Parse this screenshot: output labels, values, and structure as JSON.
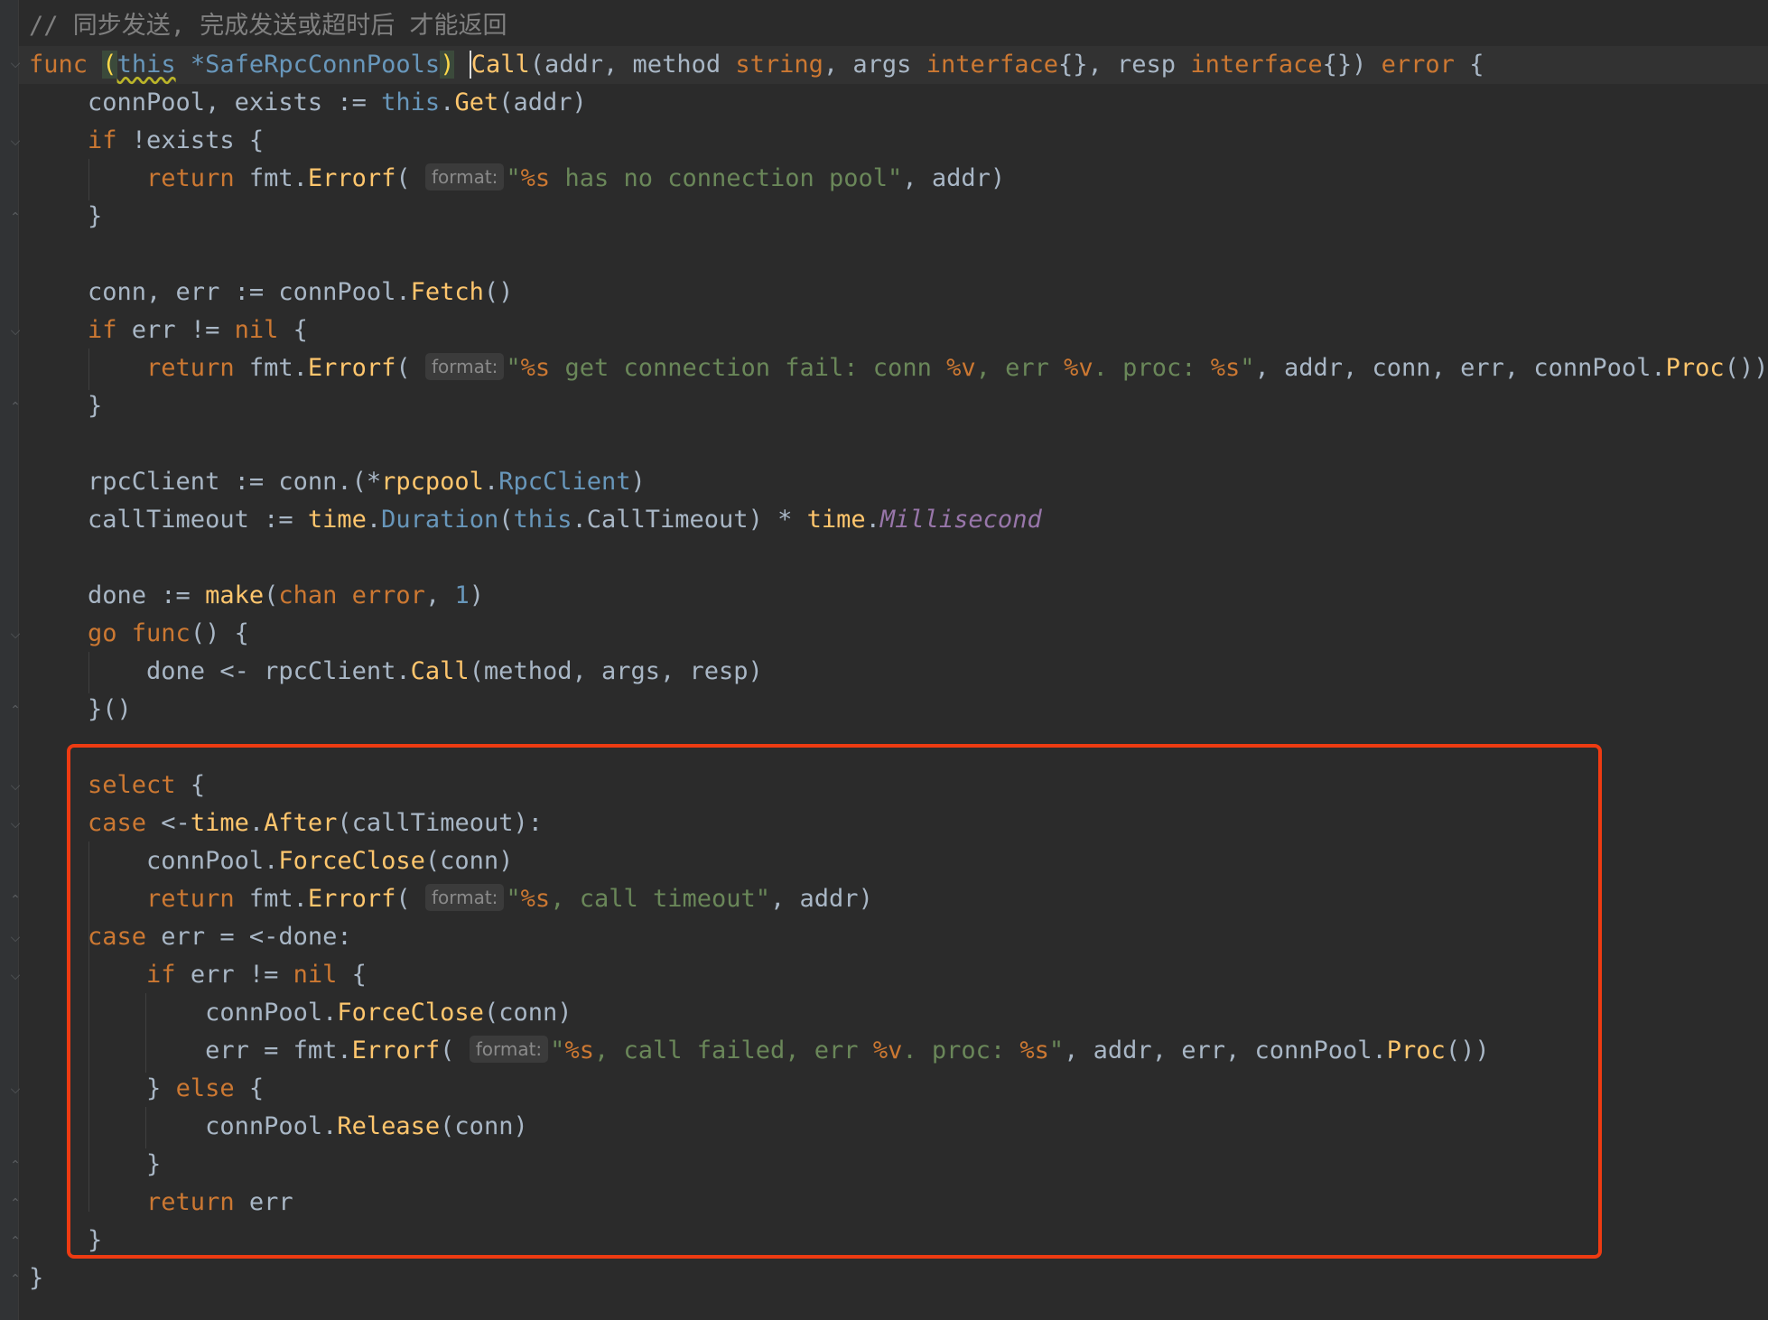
{
  "editor": {
    "comment": "// 同步发送, 完成发送或超时后 才能返回",
    "colors": {
      "background": "#2b2b2b",
      "keyword": "#cc7832",
      "function": "#ffc66d",
      "string": "#6a8759",
      "comment": "#808080",
      "highlight_box": "#ee3b12"
    },
    "hint_label": "format:",
    "lines": {
      "l2_func": "func",
      "l2_open": "(",
      "l2_this": "this",
      "l2_recv": " *SafeRpcConnPools",
      "l2_close": ")",
      "l2_name": "Call",
      "l2_sig1": "(addr, method ",
      "l2_string": "string",
      "l2_sig2": ", args ",
      "l2_iface1": "interface",
      "l2_sig3": "{}, resp ",
      "l2_iface2": "interface",
      "l2_sig4": "{}) ",
      "l2_error": "error",
      "l2_end": " {",
      "l3_a": "    connPool, exists := ",
      "l3_this": "this",
      "l3_b": ".",
      "l3_get": "Get",
      "l3_c": "(addr)",
      "l4_if": "    if",
      "l4_rest": " !exists {",
      "l5_ret": "        return",
      "l5_fmt": " fmt.",
      "l5_errf": "Errorf",
      "l5_paren": "(",
      "l5_s1": "\"",
      "l5_pct": "%s",
      "l5_s2": " has no connection pool\"",
      "l5_end": ", addr)",
      "l6": "    }",
      "l8_a": "    conn, err := connPool.",
      "l8_fetch": "Fetch",
      "l8_b": "()",
      "l9_if": "    if",
      "l9_a": " err != ",
      "l9_nil": "nil",
      "l9_b": " {",
      "l10_ret": "        return",
      "l10_fmt": " fmt.",
      "l10_errf": "Errorf",
      "l10_paren": "(",
      "l10_q": "\"",
      "l10_p1": "%s",
      "l10_s1": " get connection fail: conn ",
      "l10_p2": "%v",
      "l10_s2": ", err ",
      "l10_p3": "%v",
      "l10_s3": ". proc: ",
      "l10_p4": "%s",
      "l10_s4": "\"",
      "l10_args": ", addr, conn, err, connPool.",
      "l10_proc": "Proc",
      "l10_end": "())",
      "l11": "    }",
      "l13_a": "    rpcClient := conn.(*",
      "l13_pkg": "rpcpool",
      "l13_dot": ".",
      "l13_type": "RpcClient",
      "l13_end": ")",
      "l14_a": "    callTimeout := ",
      "l14_time": "time",
      "l14_dot": ".",
      "l14_dur": "Duration",
      "l14_b": "(",
      "l14_this": "this",
      "l14_c": ".CallTimeout) * ",
      "l14_time2": "time",
      "l14_dot2": ".",
      "l14_ms": "Millisecond",
      "l16_a": "    done := ",
      "l16_make": "make",
      "l16_b": "(",
      "l16_chan": "chan error",
      "l16_c": ", ",
      "l16_num": "1",
      "l16_d": ")",
      "l17_go": "    go func",
      "l17_b": "() {",
      "l18_a": "        done <- rpcClient.",
      "l18_call": "Call",
      "l18_b": "(method, args, resp)",
      "l19": "    }()",
      "l21_sel": "    select",
      "l21_b": " {",
      "l22_case": "    case",
      "l22_a": " <-",
      "l22_time": "time",
      "l22_dot": ".",
      "l22_after": "After",
      "l22_b": "(callTimeout):",
      "l23_a": "        connPool.",
      "l23_fc": "ForceClose",
      "l23_b": "(conn)",
      "l24_ret": "        return",
      "l24_fmt": " fmt.",
      "l24_errf": "Errorf",
      "l24_paren": "(",
      "l24_q": "\"",
      "l24_p": "%s",
      "l24_s": ", call timeout\"",
      "l24_end": ", addr)",
      "l25_case": "    case",
      "l25_a": " err = <-done:",
      "l26_if": "        if",
      "l26_a": " err != ",
      "l26_nil": "nil",
      "l26_b": " {",
      "l27_a": "            connPool.",
      "l27_fc": "ForceClose",
      "l27_b": "(conn)",
      "l28_a": "            err = fmt.",
      "l28_errf": "Errorf",
      "l28_paren": "(",
      "l28_q": "\"",
      "l28_p1": "%s",
      "l28_s1": ", call failed, err ",
      "l28_p2": "%v",
      "l28_s2": ". proc: ",
      "l28_p3": "%s",
      "l28_s3": "\"",
      "l28_args": ", addr, err, connPool.",
      "l28_proc": "Proc",
      "l28_end": "())",
      "l29_a": "        } ",
      "l29_else": "else",
      "l29_b": " {",
      "l30_a": "            connPool.",
      "l30_rel": "Release",
      "l30_b": "(conn)",
      "l31": "        }",
      "l32_ret": "        return",
      "l32_a": " err",
      "l33": "    }",
      "l34": "}"
    }
  }
}
